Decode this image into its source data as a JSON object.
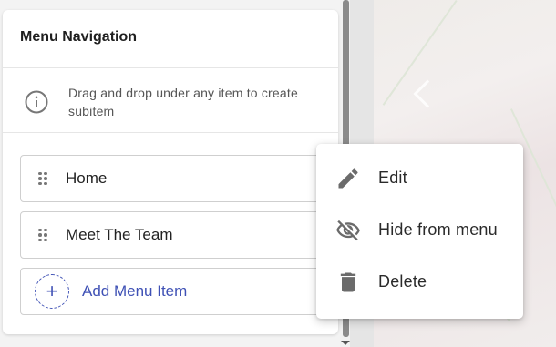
{
  "panel": {
    "title": "Menu Navigation",
    "hint": "Drag and drop under any item to create subitem"
  },
  "menu_items": [
    {
      "label": "Home"
    },
    {
      "label": "Meet The Team"
    }
  ],
  "add_item": {
    "label": "Add Menu Item"
  },
  "context_menu": {
    "items": [
      {
        "label": "Edit",
        "icon": "pencil-icon"
      },
      {
        "label": "Hide from menu",
        "icon": "eye-off-icon"
      },
      {
        "label": "Delete",
        "icon": "trash-icon"
      }
    ]
  },
  "colors": {
    "accent": "#3f51b5",
    "icon_gray": "#6b6b6b"
  }
}
